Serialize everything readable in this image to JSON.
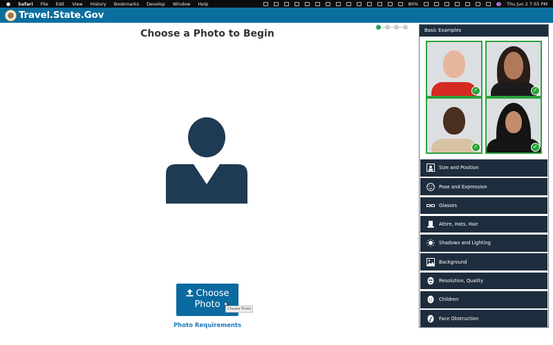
{
  "menubar": {
    "app": "Safari",
    "items": [
      "File",
      "Edit",
      "View",
      "History",
      "Bookmarks",
      "Develop",
      "Window",
      "Help"
    ],
    "battery": "80%",
    "datetime": "Thu Jun 2  7:55 PM"
  },
  "header": {
    "site_title": "Travel.State.Gov"
  },
  "main": {
    "title": "Choose a Photo to Begin",
    "stepper": {
      "total_steps": 4,
      "current_step": 1,
      "active_color": "#1ea54c"
    },
    "choose_button": {
      "line1": "Choose",
      "line2": "Photo"
    },
    "tooltip": "Choose Photo",
    "requirements_link": "Photo Requirements"
  },
  "panel": {
    "header": "Basic Examples",
    "examples": [
      {
        "label": "example-1",
        "status": "approved"
      },
      {
        "label": "example-2",
        "status": "approved"
      },
      {
        "label": "example-3",
        "status": "approved"
      },
      {
        "label": "example-4",
        "status": "approved"
      }
    ],
    "items": [
      {
        "label": "Size and Position",
        "icon": "portrait-frame-icon"
      },
      {
        "label": "Pose and Expression",
        "icon": "face-neutral-icon"
      },
      {
        "label": "Glasses",
        "icon": "glasses-icon"
      },
      {
        "label": "Attire, Hats, Hair",
        "icon": "top-hat-icon"
      },
      {
        "label": "Shadows and Lighting",
        "icon": "sun-icon"
      },
      {
        "label": "Background",
        "icon": "landscape-image-icon"
      },
      {
        "label": "Resolution, Quality",
        "icon": "pixelated-face-icon"
      },
      {
        "label": "Children",
        "icon": "baby-face-icon"
      },
      {
        "label": "Face Obstruction",
        "icon": "hand-over-face-icon"
      }
    ]
  },
  "colors": {
    "brand_blue": "#0a6f9f",
    "panel_navy": "#1e2d3d",
    "success_green": "#2aa33b",
    "link_blue": "#1e7ab8"
  }
}
